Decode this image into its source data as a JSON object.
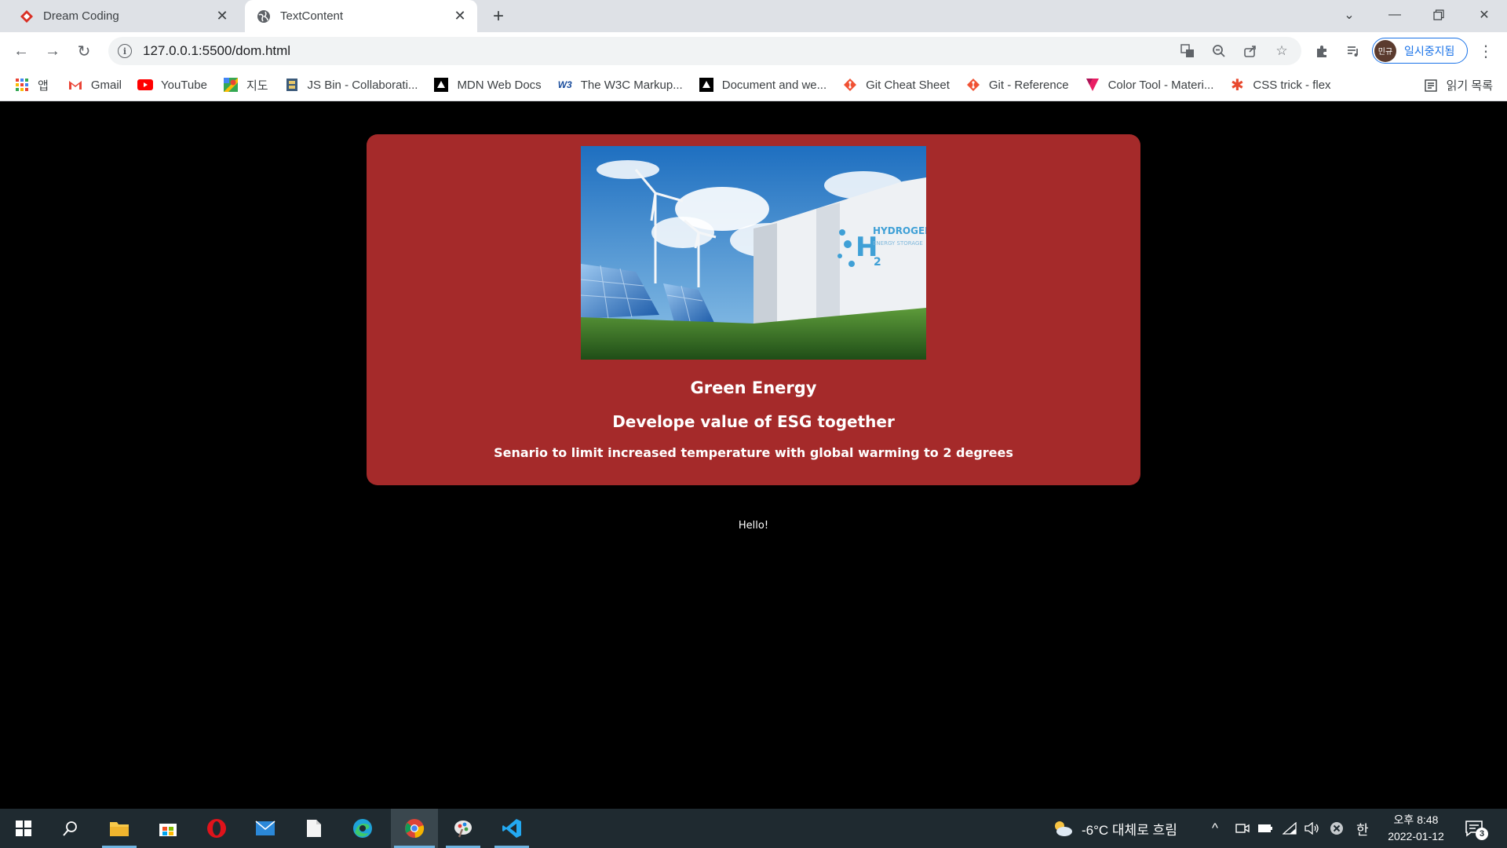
{
  "browser": {
    "tabs": [
      {
        "title": "Dream Coding",
        "active": false
      },
      {
        "title": "TextContent",
        "active": true
      }
    ],
    "url": "127.0.0.1:5500/dom.html",
    "profile_label": "일시중지됨",
    "profile_initials": "민규",
    "bookmarks": [
      "앱",
      "Gmail",
      "YouTube",
      "지도",
      "JS Bin - Collaborati...",
      "MDN Web Docs",
      "The W3C Markup...",
      "Document and we...",
      "Git Cheat Sheet",
      "Git - Reference",
      "Color Tool - Materi...",
      "CSS trick - flex"
    ],
    "reading_list": "읽기 목록"
  },
  "page": {
    "card": {
      "title": "Green Energy",
      "subtitle": "Develope value of ESG together",
      "description": "Senario to limit increased temperature with global warming to 2 degrees",
      "image_label": "HYDROGEN",
      "image_sublabel": "ENERGY STORAGE",
      "background": "#a52a2a"
    },
    "hello": "Hello!"
  },
  "taskbar": {
    "weather": "-6°C 대체로 흐림",
    "ime": "한",
    "time": "오후 8:48",
    "date": "2022-01-12",
    "notifications": "3"
  }
}
